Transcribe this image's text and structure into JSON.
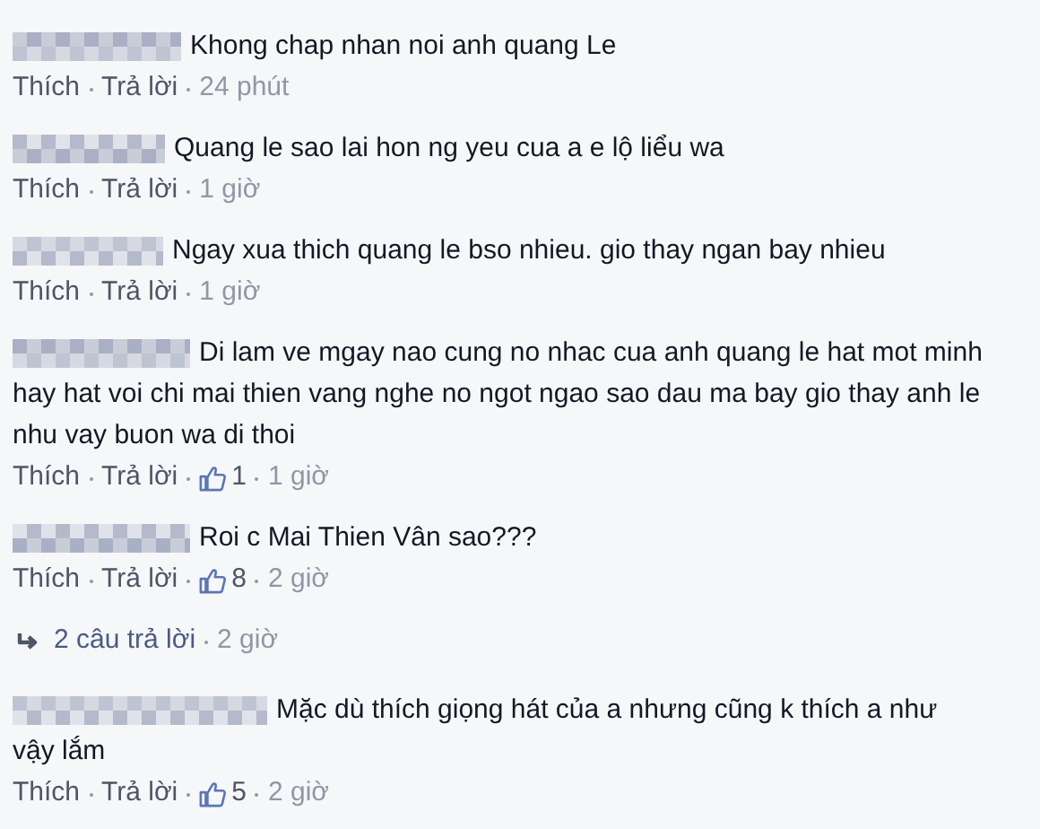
{
  "comments": [
    {
      "lines": [
        "Khong chap nhan noi anh quang Le"
      ],
      "like": "Thích",
      "reply": "Trả lời",
      "time": "24 phút"
    },
    {
      "lines": [
        "Quang le sao lai hon ng yeu cua a e lộ liểu wa"
      ],
      "like": "Thích",
      "reply": "Trả lời",
      "time": "1 giờ"
    },
    {
      "lines": [
        "Ngay xua thich quang le bso nhieu. gio thay ngan bay nhieu"
      ],
      "like": "Thích",
      "reply": "Trả lời",
      "time": "1 giờ"
    },
    {
      "lines": [
        "Di lam ve mgay nao cung no nhac cua anh quang le hat mot minh",
        "hay hat voi chi mai thien vang nghe no ngot ngao sao dau ma bay gio thay anh le",
        "nhu vay buon wa di thoi"
      ],
      "like": "Thích",
      "reply": "Trả lời",
      "likes": "1",
      "time": "1 giờ"
    },
    {
      "lines": [
        "Roi c Mai Thien Vân sao???"
      ],
      "like": "Thích",
      "reply": "Trả lời",
      "likes": "8",
      "time": "2 giờ",
      "replies": {
        "text": "2 câu trả lời",
        "time": "2 giờ"
      }
    },
    {
      "lines": [
        "Mặc dù thích giọng hát của a nhưng cũng k thích a như",
        "vậy lắm"
      ],
      "like": "Thích",
      "reply": "Trả lời",
      "likes": "5",
      "time": "2 giờ"
    }
  ]
}
